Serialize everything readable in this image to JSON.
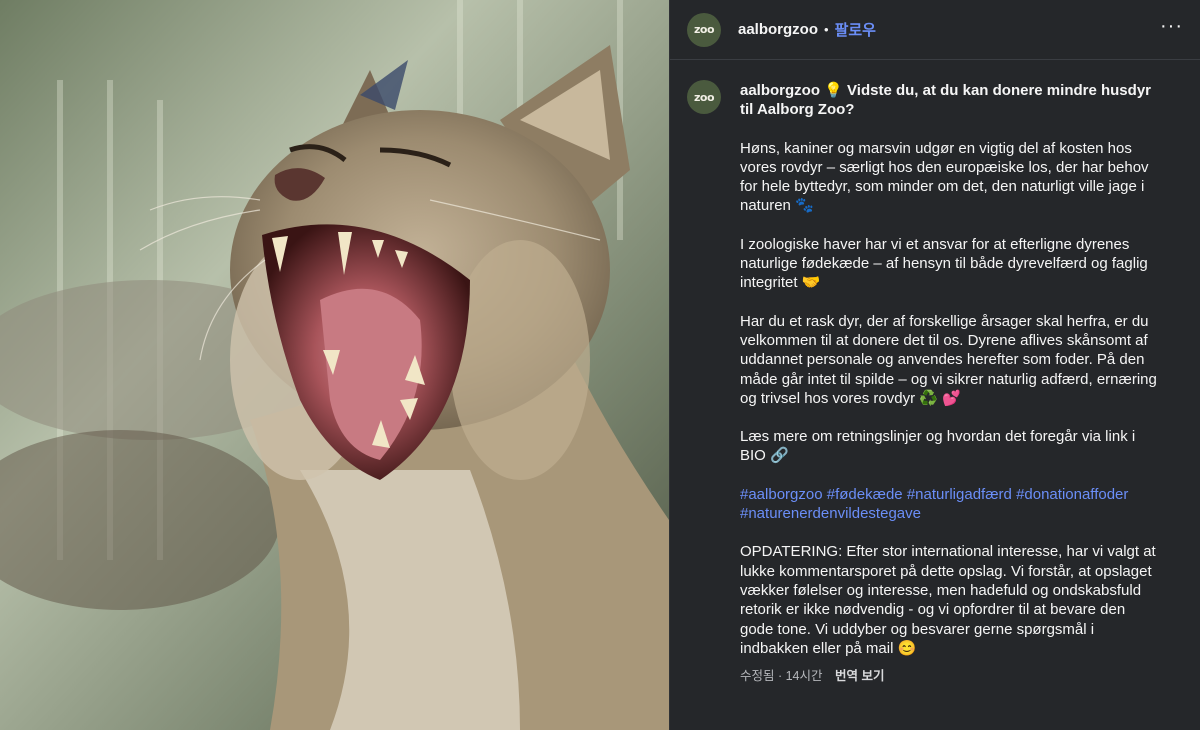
{
  "photo": {
    "subject": "yawning Eurasian lynx",
    "colors": {
      "fur": "#9c8b70",
      "mouth": "#6b2a2a",
      "tongue": "#c87a82",
      "background": "#8a9580"
    }
  },
  "header": {
    "avatar_text": "zoo",
    "username": "aalborgzoo",
    "separator": "•",
    "follow_label": "팔로우",
    "more_icon": "more-horizontal-icon",
    "more_symbol": "···"
  },
  "post": {
    "avatar_text": "zoo",
    "username": "aalborgzoo",
    "title_emoji": "💡",
    "title": "Vidste du, at du kan donere mindre husdyr til Aalborg Zoo?",
    "paragraphs": [
      "Høns, kaniner og marsvin udgør en vigtig del af kosten hos vores rovdyr – særligt hos den europæiske los, der har behov for hele byttedyr, som minder om det, den naturligt ville jage i naturen 🐾",
      "I zoologiske haver har vi et ansvar for at efterligne dyrenes naturlige fødekæde – af hensyn til både dyrevelfærd og faglig integritet 🤝",
      "Har du et rask dyr, der af forskellige årsager skal herfra, er du velkommen til at donere det til os. Dyrene aflives skånsomt af uddannet personale og anvendes herefter som foder. På den måde går intet til spilde – og vi sikrer naturlig adfærd, ernæring og trivsel hos vores rovdyr ♻️ 💕",
      "Læs mere om retningslinjer og hvordan det foregår via link i BIO 🔗"
    ],
    "hashtags": [
      "#aalborgzoo",
      "#fødekæde",
      "#naturligadfærd",
      "#donationaffoder",
      "#naturenerdenvildestegave"
    ],
    "update": "OPDATERING: Efter stor international interesse, har vi valgt at lukke kommentarsporet på dette opslag. Vi forstår, at opslaget vækker følelser og interesse, men hadefuld og ondskabsfuld retorik er ikke nødvendig - og vi opfordrer til at bevare den gode tone. Vi uddyber og besvarer gerne spørgsmål i indbakken eller på mail 😊",
    "meta_time": "수정됨 · 14시간",
    "translate_label": "번역 보기"
  }
}
